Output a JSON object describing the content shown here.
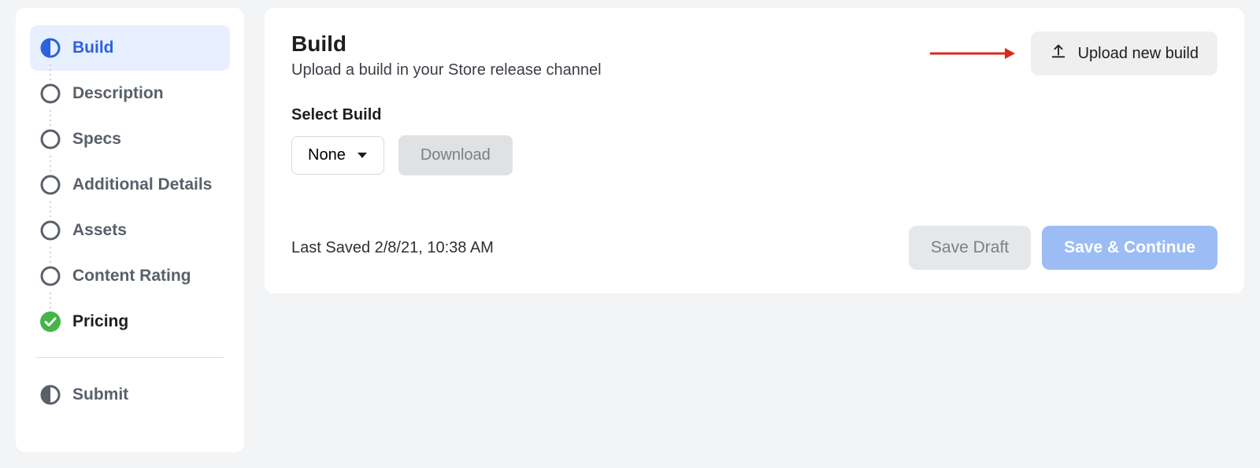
{
  "sidebar": {
    "items": [
      {
        "label": "Build",
        "state": "active"
      },
      {
        "label": "Description",
        "state": "pending"
      },
      {
        "label": "Specs",
        "state": "pending"
      },
      {
        "label": "Additional Details",
        "state": "pending"
      },
      {
        "label": "Assets",
        "state": "pending"
      },
      {
        "label": "Content Rating",
        "state": "pending"
      },
      {
        "label": "Pricing",
        "state": "completed"
      }
    ],
    "submit_label": "Submit"
  },
  "main": {
    "title": "Build",
    "description": "Upload a build in your Store release channel",
    "upload_button": "Upload new build",
    "select_build_label": "Select Build",
    "select_value": "None",
    "download_button": "Download",
    "last_saved": "Last Saved 2/8/21, 10:38 AM",
    "save_draft": "Save Draft",
    "save_continue": "Save & Continue"
  }
}
